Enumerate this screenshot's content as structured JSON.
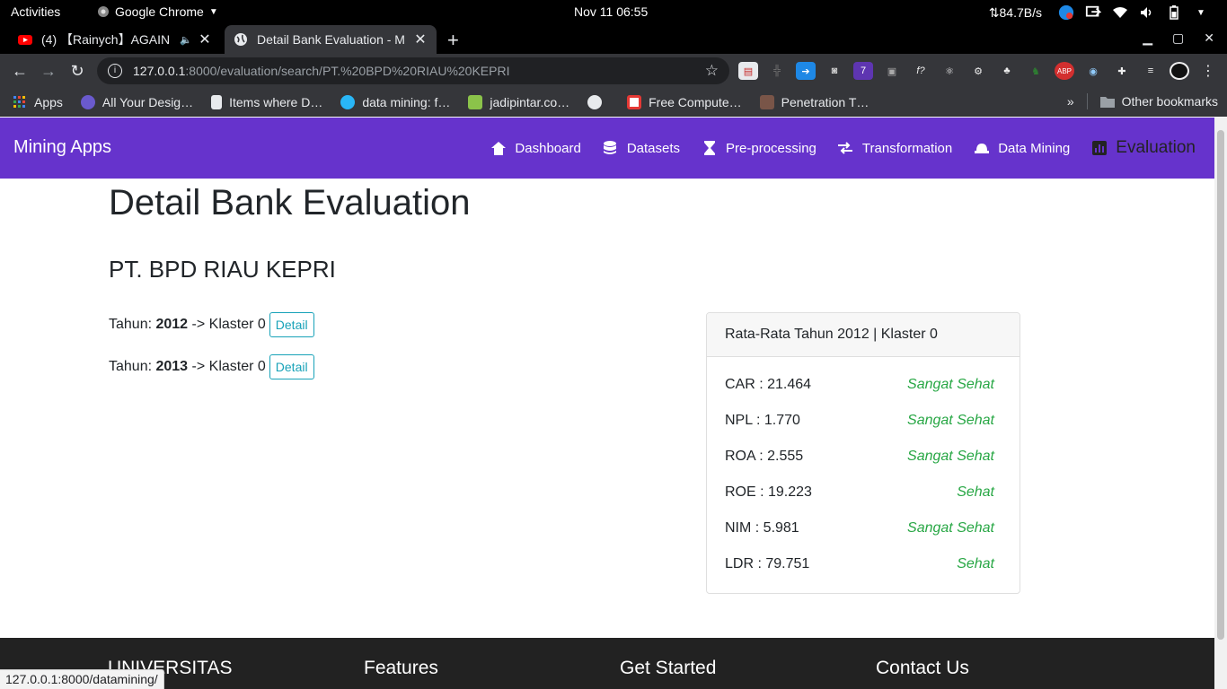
{
  "system": {
    "activities": "Activities",
    "app_name": "Google Chrome",
    "clock": "Nov 11  06:55",
    "net_speed": "⇅84.7B/s"
  },
  "browser": {
    "tabs": [
      {
        "title": "(4) 【Rainych】AGAIN",
        "active": false
      },
      {
        "title": "Detail Bank Evaluation - M",
        "active": true
      }
    ],
    "url_host": "127.0.0.1",
    "url_path": ":8000/evaluation/search/PT.%20BPD%20RIAU%20KEPRI",
    "bookmarks": [
      {
        "label": "Apps"
      },
      {
        "label": "All Your Desig…"
      },
      {
        "label": "Items where D…"
      },
      {
        "label": "data mining: f…"
      },
      {
        "label": "jadipintar.co…"
      },
      {
        "label": ""
      },
      {
        "label": "Free Compute…"
      },
      {
        "label": "Penetration T…"
      }
    ],
    "other_bookmarks": "Other bookmarks",
    "status_url": "127.0.0.1:8000/datamining/"
  },
  "navbar": {
    "brand": "Mining Apps",
    "links": [
      {
        "label": "Dashboard",
        "icon": "home-icon"
      },
      {
        "label": "Datasets",
        "icon": "database-icon"
      },
      {
        "label": "Pre-processing",
        "icon": "hourglass-icon"
      },
      {
        "label": "Transformation",
        "icon": "exchange-icon"
      },
      {
        "label": "Data Mining",
        "icon": "hard-hat-icon"
      },
      {
        "label": "Evaluation",
        "icon": "bar-chart-icon",
        "active": true
      }
    ]
  },
  "main": {
    "title": "Detail Bank Evaluation",
    "bank": "PT. BPD RIAU KEPRI",
    "years": [
      {
        "prefix": "Tahun: ",
        "year": "2012",
        "cluster": " -> Klaster 0",
        "button": "Detail"
      },
      {
        "prefix": "Tahun: ",
        "year": "2013",
        "cluster": " -> Klaster 0",
        "button": "Detail"
      }
    ],
    "card": {
      "header": "Rata-Rata Tahun 2012 | Klaster 0",
      "metrics": [
        {
          "label": "CAR : 21.464",
          "status": "Sangat Sehat"
        },
        {
          "label": "NPL : 1.770",
          "status": "Sangat Sehat"
        },
        {
          "label": "ROA : 2.555",
          "status": "Sangat Sehat"
        },
        {
          "label": "ROE : 19.223",
          "status": "Sehat"
        },
        {
          "label": "NIM : 5.981",
          "status": "Sangat Sehat"
        },
        {
          "label": "LDR : 79.751",
          "status": "Sehat"
        }
      ]
    }
  },
  "footer": {
    "cols": [
      "UNIVERSITAS",
      "Features",
      "Get Started",
      "Contact Us"
    ]
  },
  "colors": {
    "navbar": "#6633cc",
    "status_good": "#28a745",
    "detail_button": "#17a2b8",
    "footer": "#222222"
  }
}
